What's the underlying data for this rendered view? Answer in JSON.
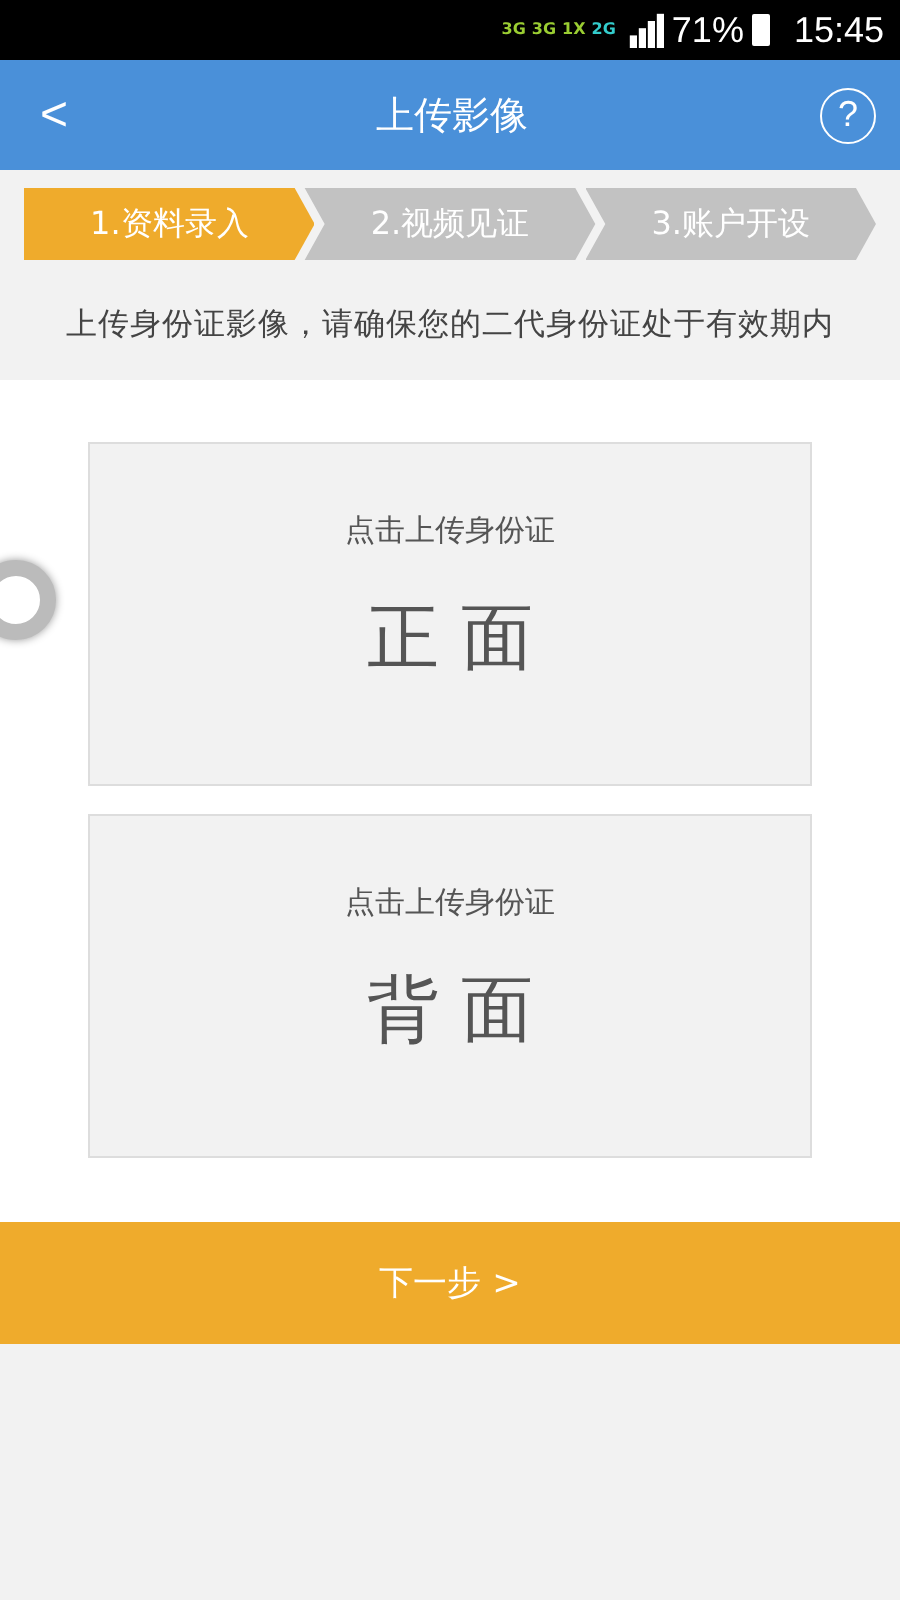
{
  "status_bar": {
    "network_labels": [
      {
        "text": "3G",
        "color": "#9acd32"
      },
      {
        "text": "3G",
        "color": "#9acd32"
      },
      {
        "text": "1X",
        "color": "#9acd32"
      },
      {
        "text": "2G",
        "color": "#33cccc"
      }
    ],
    "battery": "71%",
    "time": "15:45"
  },
  "header": {
    "back": "<",
    "title": "上传影像",
    "help": "?"
  },
  "steps": [
    {
      "label": "1.资料录入",
      "selected": true
    },
    {
      "label": "2.视频见证",
      "selected": false
    },
    {
      "label": "3.账户开设",
      "selected": false
    }
  ],
  "notice": "上传身份证影像，请确保您的二代身份证处于有效期内",
  "upload_cards": [
    {
      "hint": "点击上传身份证",
      "side": "正 面"
    },
    {
      "hint": "点击上传身份证",
      "side": "背 面"
    }
  ],
  "next_button": "下一步 >"
}
